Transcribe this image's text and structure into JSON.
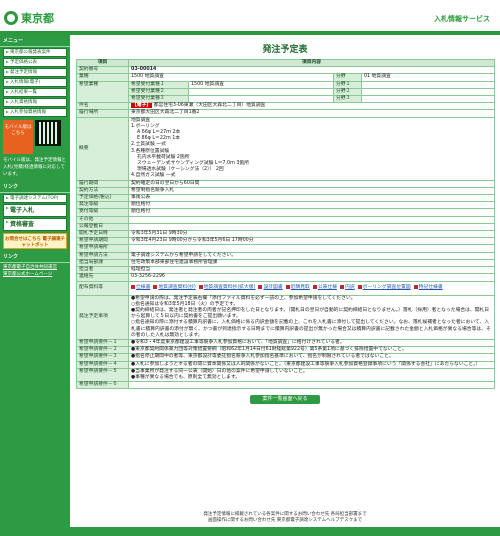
{
  "header": {
    "logo": "東京都",
    "service": "入札情報サービス"
  },
  "sidebar": {
    "menu_head": "メニュー",
    "items": [
      "東京都公報発表案件",
      "予定価格公表",
      "発注予定情報",
      "入札情報(電子)",
      "入札結果一覧",
      "入札資格情報",
      "入札参加資格情報"
    ],
    "mobile_label": "モバイル版はこちら",
    "mobile_note": "モバイル版は、発注予定情報と入札(見積)経過情報に対応しています。",
    "links_head": "リンク",
    "big_items": [
      "電子調達システム(TOP)",
      "電子入札",
      "資格審査"
    ],
    "inquiry": "お問合せはこちら 電子調達チャットボット",
    "link_head2": "リンク",
    "ext_links": [
      "東京都電子自治体共同運営",
      "東京都公式ホームページ"
    ]
  },
  "page": {
    "title": "発注予定表",
    "col_item": "項目",
    "col_content": "項目内容"
  },
  "rows": {
    "contract_no": {
      "k": "契約番号",
      "v": "03-00014"
    },
    "business": {
      "k": "業種",
      "v": "1500 地質調査",
      "k2": "分野",
      "v2": "01 地質調査"
    },
    "desired": {
      "k": "希望業種",
      "r1k": "希望受付業種１",
      "r1v": "1500 地質調査",
      "r2k": "希望受付業種２",
      "r3k": "希望受付業種３",
      "s1": "分野１",
      "s2": "分野２",
      "s3": "分野３"
    },
    "name": {
      "k": "件名",
      "tag": "【電子】",
      "v": "都営住宅3-06東瀬（大田区大森北二丁目）地質調査"
    },
    "location": {
      "k": "履行場所",
      "v": "東京都大田区大森北二丁目1番2"
    },
    "summary": {
      "k": "概要",
      "lines": [
        "地質調査",
        "1.ボーリング",
        "A 66φ L＝27ｍ 2本",
        "E 86φ L＝22ｍ 1本",
        "2.土質試験 一式",
        "3.各種原位置試験",
        "孔内水平載荷試験 2箇所",
        "スウェーデン式サウンディング試験 L＝7.0ｍ 3箇所",
        "現場透水試験（ケーシング法（2）） 2回",
        "4.自然ガス試験 一式"
      ]
    },
    "period": {
      "k": "履行期間",
      "v": "契約確定の日の翌日から60日間"
    },
    "method": {
      "k": "契約方法",
      "v": "希望制指名競争入札"
    },
    "price": {
      "k": "予定価格(税込)",
      "v": "事後公表"
    },
    "order_q": {
      "k": "発注等級",
      "v": "順位格付"
    },
    "accept_q": {
      "k": "受付等級",
      "v": "順位格付"
    },
    "other": {
      "k": "その他",
      "v": ""
    },
    "notice_date": {
      "k": "公報登載日",
      "v": ""
    },
    "open_date": {
      "k": "開札予定日時",
      "v": "令和3年5月31日 9時30分"
    },
    "apply_period": {
      "k": "希望申請期間",
      "v": "令和3年4月23日 9時00分から令和3年5月6日 17時00分"
    },
    "apply_place": {
      "k": "希望申請場所",
      "v": ""
    },
    "apply_method": {
      "k": "希望申請方法",
      "v": "電子調達システムから希望申請をしてください。"
    },
    "dept": {
      "k": "担当局部課",
      "v": "住宅政策本部東部住宅建設事務所管理課"
    },
    "person": {
      "k": "担当者",
      "v": "経理担当"
    },
    "contact": {
      "k": "連絡先",
      "v": "03-3256-2296"
    },
    "docs": {
      "k": "配布資料等",
      "v": [
        "仕様書",
        "地質調査資料(抄)",
        "地質調査資料抄(拡大版)",
        "設計図書",
        "近隣見取",
        "公表仕様",
        "内訳",
        "ボーリング調査位置図",
        "特記仕様書"
      ]
    },
    "notes": {
      "k": "発注予定事項",
      "lines": [
        "●希望申請の際は、発注予定表右欄「添付ファイル資料を必ず一読の上、参加希望申請をしてください。",
        "○指名通知は令和3年5月18日（火）の予定です。",
        "●契約締結日は、発注者と発注者の両者が記名押印をした日となります。（開札日の翌日が自動的に契約締結日となりません。）落札（採用）者となった場合は、開札日から起算して５日以内に契約書をご提出願います。",
        "○指名通知の際に添付する積算内訳書に、入札価格に係る内訳金額を記載の上、これを入札書に添付して提出してください。なお、落札候補者となった者において、入札書に積算内訳書の添付が無く、かつ書が到達指示する日時までに積算内訳書の提出が無かった場合又は積算内訳書に記載された金額と入札価格が異なる場合等は、その者のした入札は無効とします。"
      ]
    },
    "req1": {
      "k": "希望申請要件－１",
      "v": "●令和3・4年度東京都建設工事等競争入札参加資格において、「地質調査」に格付けされている者。"
    },
    "req2": {
      "k": "希望申請要件－２",
      "v": "●東京都契約関係暴力団等対策措置要綱（昭和62年1月14日付61財経総第922号）第5条第1項に基づく排除措置中でないこと。"
    },
    "req3": {
      "k": "希望申請要件－３",
      "v": "●指名停止期間中の者等、東京都設計等委託指名競争入札参加指名基準において、指名が制限されている者ではないこと。"
    },
    "req4": {
      "k": "希望申請要件－４",
      "v": "●入札に参加しようとする者の間に資本関係又は人的関係がないこと。（東京都建設工事等競争入札参加資格登録事項にいう「関係する会社」にあたらないこと。）"
    },
    "req5": {
      "k": "希望申請要件－５",
      "v": "●当事業所が発注する同一公表（開始）日の他の案件に希望申請していないこと。\n●事種が異なる場合でも、原則全て無効とします。"
    },
    "req6": {
      "k": "希望申請要件－６",
      "v": ""
    }
  },
  "list_button": "案件一覧画面へ戻る",
  "footer": [
    "発注予定情報に掲載されている各案件に関するお問い合わせ先 各局担当部署まで",
    "画面操作に関するお問い合わせ先 東京都電子調達システムヘルプデスクまで"
  ]
}
